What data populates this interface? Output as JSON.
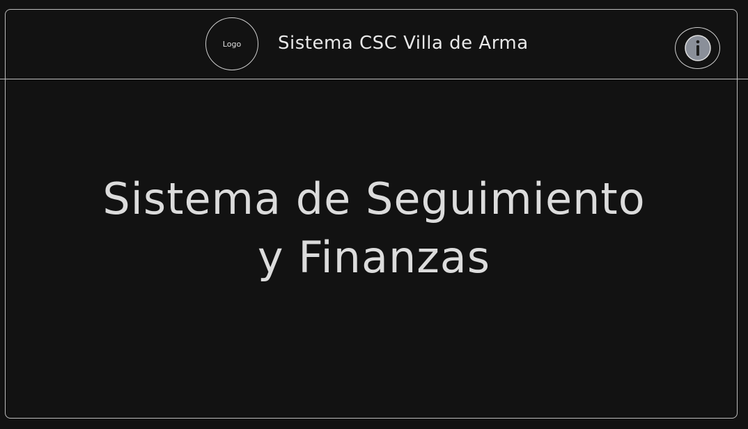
{
  "header": {
    "logo_label": "Logo",
    "title": "Sistema CSC Villa de Arma",
    "info_icon": "info-icon"
  },
  "main": {
    "heading_line1": "Sistema de Seguimiento",
    "heading_line2": "y Finanzas"
  },
  "colors": {
    "background": "#121212",
    "stroke": "#bdbdbd",
    "text": "#e6e6e6",
    "info_icon_fill": "#8a8f99"
  }
}
